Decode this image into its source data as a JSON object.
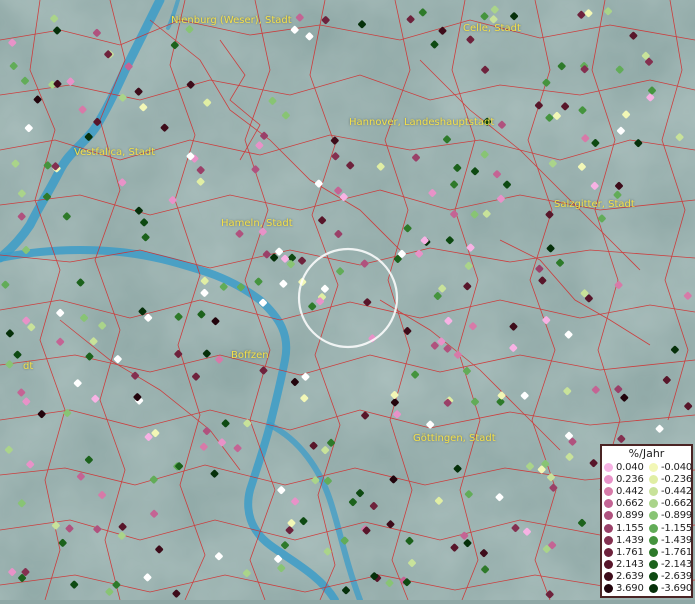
{
  "map": {
    "cities": [
      {
        "name": "Nienburg (Weser), Stadt",
        "lon": 9.21,
        "lat": 52.64
      },
      {
        "name": "Celle, Stadt",
        "lon": 10.08,
        "lat": 52.62
      },
      {
        "name": "Hannover, Landeshauptstadt",
        "lon": 9.74,
        "lat": 52.37
      },
      {
        "name": "Vestfalica, Stadt",
        "lon": 8.92,
        "lat": 52.29
      },
      {
        "name": "Salzgitter, Stadt",
        "lon": 10.35,
        "lat": 52.15
      },
      {
        "name": "Hameln, Stadt",
        "lon": 9.36,
        "lat": 52.1
      },
      {
        "name": "Boffzen",
        "lon": 9.39,
        "lat": 51.75
      },
      {
        "name": "Göttingen, Stadt",
        "lon": 9.93,
        "lat": 51.53
      },
      {
        "name": "dt",
        "lon": 8.77,
        "lat": 51.72
      }
    ],
    "colors": {
      "background": "#8fa8a6",
      "river": "#3c9cc8",
      "borders": "#d42a2a",
      "label": "#f4e04a",
      "highlight_ring": "#ffffff"
    }
  },
  "legend": {
    "title": "%/Jahr",
    "rows": [
      {
        "pos": "0.040",
        "pos_color": "#f7b2e4",
        "neg": "-0.040",
        "neg_color": "#f2f7b6"
      },
      {
        "pos": "0.236",
        "pos_color": "#e892c8",
        "neg": "-0.236",
        "neg_color": "#e0eea4"
      },
      {
        "pos": "0.442",
        "pos_color": "#d77aa8",
        "neg": "-0.442",
        "neg_color": "#c8e29a"
      },
      {
        "pos": "0.662",
        "pos_color": "#c46494",
        "neg": "-0.662",
        "neg_color": "#aad48a"
      },
      {
        "pos": "0.899",
        "pos_color": "#b0527e",
        "neg": "-0.899",
        "neg_color": "#88c474"
      },
      {
        "pos": "1.155",
        "pos_color": "#9a4068",
        "neg": "-1.155",
        "neg_color": "#62ac58"
      },
      {
        "pos": "1.439",
        "pos_color": "#843050",
        "neg": "-1.439",
        "neg_color": "#45943e"
      },
      {
        "pos": "1.761",
        "pos_color": "#6e223c",
        "neg": "-1.761",
        "neg_color": "#2e7a2a"
      },
      {
        "pos": "2.143",
        "pos_color": "#58162a",
        "neg": "-2.143",
        "neg_color": "#1c621c"
      },
      {
        "pos": "2.639",
        "pos_color": "#3e0c1a",
        "neg": "-2.639",
        "neg_color": "#0e4a12"
      },
      {
        "pos": "3.690",
        "pos_color": "#22040c",
        "neg": "-3.690",
        "neg_color": "#06300a"
      }
    ]
  }
}
